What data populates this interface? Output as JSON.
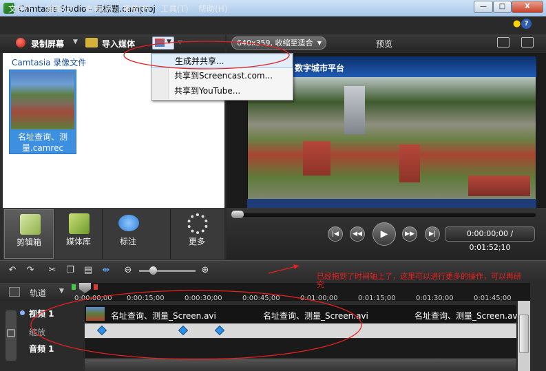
{
  "window": {
    "title": "Camtasia Studio - 无标题.camproj",
    "min": "—",
    "max": "□",
    "close": "X"
  },
  "menu": [
    "文件(F)",
    "编辑(E)",
    "查看(V)",
    "播放(P)",
    "工具(T)",
    "帮助(H)"
  ],
  "toolbar": {
    "record_label": "录制屏幕",
    "import_label": "导入媒体"
  },
  "dropdown": {
    "items": [
      "生成并共享...",
      "共享到Screencast.com...",
      "共享到YouTube..."
    ]
  },
  "preview": {
    "size_select": "640x359, 收缩至适合",
    "label": "预览",
    "video_header": "数字城市平台",
    "timecode": "0:00:00;00 / 0:01:52;10"
  },
  "clipbin": {
    "header": "Camtasia 录像文件",
    "clip_name": "名址查询、测量.camrec"
  },
  "tabs": [
    "剪辑箱",
    "媒体库",
    "标注",
    "更多"
  ],
  "timeline": {
    "tracks_label": "轨道",
    "ticks": [
      "0:00:00;00",
      "0:00:15;00",
      "0:00:30;00",
      "0:00:45;00",
      "0:01:00;00",
      "0:01:15;00",
      "0:01:30;00",
      "0:01:45;00"
    ],
    "track_video": "视频 1",
    "track_zoom": "缩放",
    "track_audio": "音频 1",
    "clip_labels": [
      "名址查询、测量_Screen.avi",
      "名址查询、测量_Screen.avi",
      "名址查询、测量_Screen.avi"
    ]
  },
  "annotation": "已经拖到了时间轴上了，这里可以进行更多的操作，可以再研究",
  "colors": {
    "annotation_red": "#e82020",
    "selection_blue": "#3d8fe0",
    "keyframe_blue": "#2f8fe3"
  }
}
